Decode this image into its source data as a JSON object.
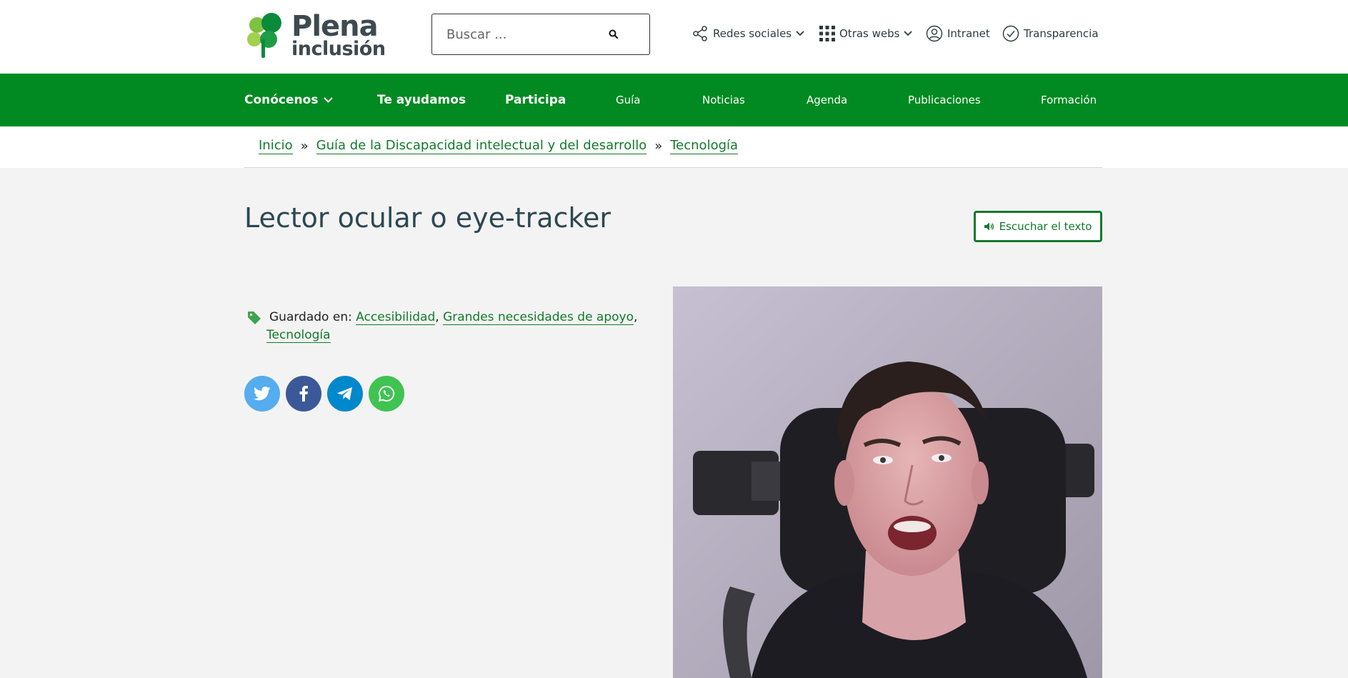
{
  "header": {
    "logo": {
      "line1": "Plena",
      "line2": "inclusión"
    },
    "search": {
      "placeholder": "Buscar ..."
    },
    "links": {
      "redes": "Redes sociales",
      "otras": "Otras webs",
      "intranet": "Intranet",
      "transparencia": "Transparencia"
    }
  },
  "nav": {
    "items": [
      {
        "label": "Conócenos"
      },
      {
        "label": "Te ayudamos"
      },
      {
        "label": "Participa"
      },
      {
        "label": "Guía"
      },
      {
        "label": "Noticias"
      },
      {
        "label": "Agenda"
      },
      {
        "label": "Publicaciones"
      },
      {
        "label": "Formación"
      }
    ]
  },
  "breadcrumb": {
    "items": [
      "Inicio",
      "Guía de la Discapacidad intelectual y del desarrollo",
      "Tecnología"
    ],
    "separator": "»"
  },
  "article": {
    "title": "Lector ocular o eye-tracker",
    "listen_label": "Escuchar el texto",
    "tags_label": "Guardado en:",
    "tags": [
      "Accesibilidad",
      "Grandes necesidades de apoyo",
      "Tecnología"
    ],
    "tag_separator": ","
  },
  "share": {
    "networks": [
      {
        "icon": "twitter-icon",
        "color": "#55acee"
      },
      {
        "icon": "facebook-icon",
        "color": "#3b5998"
      },
      {
        "icon": "telegram-icon",
        "color": "#0088cc"
      },
      {
        "icon": "whatsapp-icon",
        "color": "#3fc351"
      }
    ]
  },
  "colors": {
    "brand_green": "#008a21",
    "link_green": "#127a2a",
    "title_color": "#2c4852",
    "page_bg": "#f3f3f3"
  }
}
